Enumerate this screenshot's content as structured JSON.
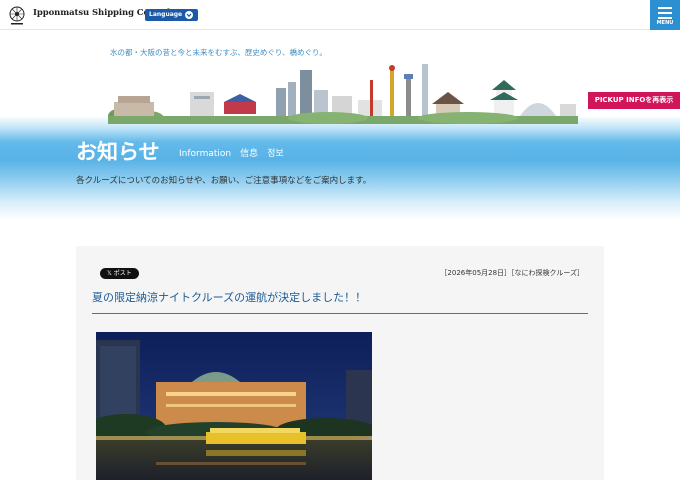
{
  "header": {
    "company_name": "Ipponmatsu Shipping Co.,Ltd",
    "language_label": "Language",
    "menu_label": "MENU"
  },
  "hero": {
    "tagline": "水の都・大阪の昔と今と未来をむすぶ、歴史めぐり、橋めぐり。",
    "pickup_label": "PICKUP INFOを再表示",
    "title": "お知らせ",
    "subtitle": "Information　信息　정보",
    "description": "各クルーズについてのお知らせや、お願い、ご注意事項などをご案内します。"
  },
  "article": {
    "share_label": "ポスト",
    "meta": "［2026年05月28日］［なにわ探検クルーズ］",
    "title": "夏の限定納涼ナイトクルーズの運航が決定しました！！"
  },
  "colors": {
    "accent_blue": "#2b8fd2",
    "pickup_pink": "#d2145a",
    "title_blue": "#1a5a95"
  },
  "icons": {
    "logo": "company-emblem",
    "language": "chevron-down-icon",
    "menu": "hamburger-icon",
    "x": "x-logo-icon"
  }
}
